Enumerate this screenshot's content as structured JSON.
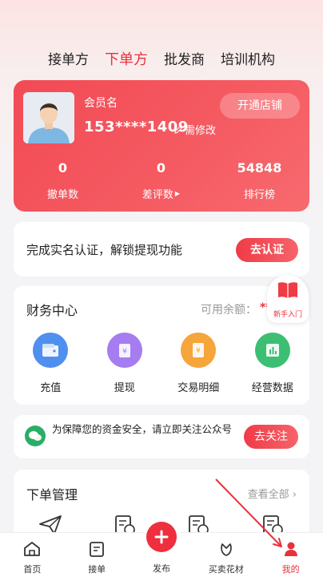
{
  "top_tabs": [
    {
      "label": "接单方"
    },
    {
      "label": "下单方",
      "active": true
    },
    {
      "label": "批发商"
    },
    {
      "label": "培训机构"
    }
  ],
  "profile": {
    "member_name": "会员名",
    "phone": "153****1409",
    "edit_label": "需修改",
    "open_shop_label": "开通店铺",
    "stats": [
      {
        "value": "0",
        "label": "撤单数"
      },
      {
        "value": "0",
        "label": "差评数"
      },
      {
        "value": "54848",
        "label": "排行榜"
      }
    ]
  },
  "verify": {
    "text": "完成实名认证，解锁提现功能",
    "button": "去认证"
  },
  "finance": {
    "title": "财务中心",
    "balance_label": "可用余额：",
    "balance_value": "**",
    "items": [
      {
        "label": "充值",
        "icon": "wallet-icon",
        "color": "#4f8ff0"
      },
      {
        "label": "提现",
        "icon": "withdraw-icon",
        "color": "#a67df0"
      },
      {
        "label": "交易明细",
        "icon": "transaction-icon",
        "color": "#f5a53a"
      },
      {
        "label": "经营数据",
        "icon": "data-chart-icon",
        "color": "#3cbf72"
      }
    ]
  },
  "guide": {
    "label": "新手入门"
  },
  "wechat": {
    "text": "为保障您的资金安全，请立即关注公众号",
    "button": "去关注"
  },
  "orders": {
    "title": "下单管理",
    "view_all": "查看全部 ›"
  },
  "tabbar": [
    {
      "label": "首页",
      "icon": "home-icon"
    },
    {
      "label": "接单",
      "icon": "receive-order-icon"
    },
    {
      "label": "发布",
      "icon": "plus-icon"
    },
    {
      "label": "买卖花材",
      "icon": "flower-icon"
    },
    {
      "label": "我的",
      "icon": "user-icon",
      "active": true
    }
  ],
  "colors": {
    "accent": "#e8323c",
    "card": "#ffffff",
    "background": "#f4f4f6"
  }
}
